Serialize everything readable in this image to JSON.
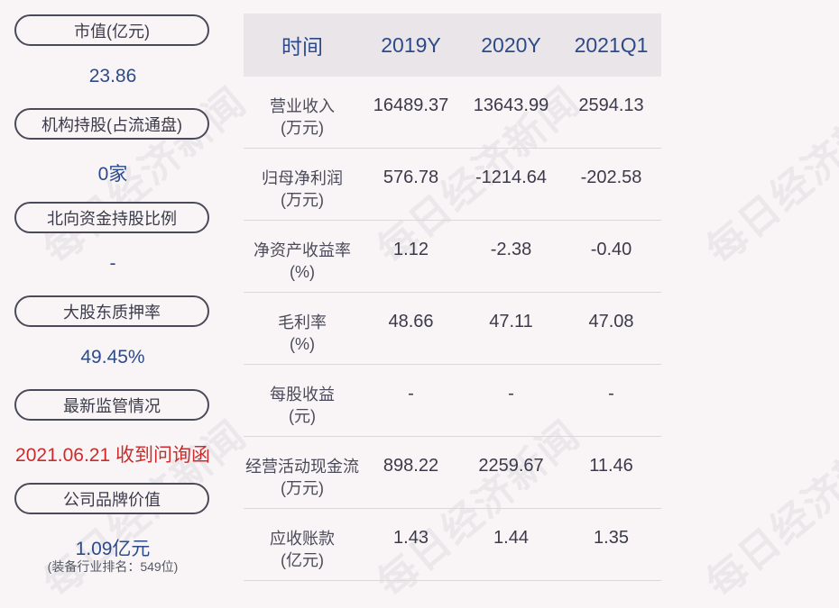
{
  "left": {
    "items": [
      {
        "label": "市值(亿元)",
        "value": "23.86"
      },
      {
        "label": "机构持股(占流通盘)",
        "value": "0家"
      },
      {
        "label": "北向资金持股比例",
        "value": "-"
      },
      {
        "label": "大股东质押率",
        "value": "49.45%"
      },
      {
        "label": "最新监管情况",
        "value": "2021.06.21 收到问询函"
      },
      {
        "label": "公司品牌价值",
        "value": "1.09亿元",
        "sub": "(装备行业排名：549位)"
      }
    ]
  },
  "table": {
    "headers": [
      "时间",
      "2019Y",
      "2020Y",
      "2021Q1"
    ],
    "rows": [
      {
        "label1": "营业收入",
        "label2": "(万元)",
        "values": [
          "16489.37",
          "13643.99",
          "2594.13"
        ]
      },
      {
        "label1": "归母净利润",
        "label2": "(万元)",
        "values": [
          "576.78",
          "-1214.64",
          "-202.58"
        ]
      },
      {
        "label1": "净资产收益率",
        "label2": "(%)",
        "values": [
          "1.12",
          "-2.38",
          "-0.40"
        ]
      },
      {
        "label1": "毛利率",
        "label2": "(%)",
        "values": [
          "48.66",
          "47.11",
          "47.08"
        ]
      },
      {
        "label1": "每股收益",
        "label2": "(元)",
        "values": [
          "-",
          "-",
          "-"
        ]
      },
      {
        "label1": "经营活动现金流",
        "label2": "(万元)",
        "values": [
          "898.22",
          "2259.67",
          "11.46"
        ]
      },
      {
        "label1": "应收账款",
        "label2": "(亿元)",
        "values": [
          "1.43",
          "1.44",
          "1.35"
        ]
      }
    ]
  },
  "watermark": "每日经济新闻",
  "colors": {
    "value_blue": "#2d4a8a",
    "alert_red": "#cc2b2b",
    "header_bg": "#e9e5e8"
  }
}
